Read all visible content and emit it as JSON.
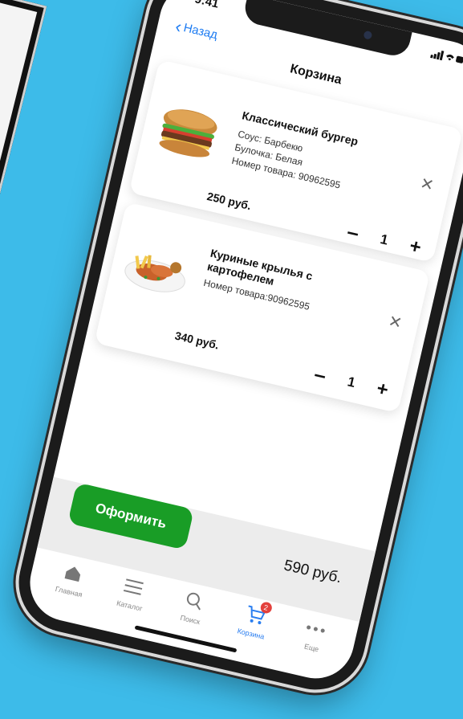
{
  "status": {
    "time": "9:41",
    "icons": "signal-wifi-battery"
  },
  "header": {
    "back_label": "Назад",
    "title": "Корзина"
  },
  "cart": {
    "items": [
      {
        "name": "Классический бургер",
        "details": [
          "Соус: Барбекю",
          "Булочка: Белая",
          "Номер товара: 90962595"
        ],
        "price": "250 руб.",
        "quantity": "1",
        "image": "burger-image"
      },
      {
        "name": "Куриные крылья с картофелем",
        "details": [
          "Номер товара:90962595"
        ],
        "price": "340 руб.",
        "quantity": "1",
        "image": "chicken-wings-image"
      }
    ],
    "checkout_label": "Оформить",
    "total": "590 руб."
  },
  "tabbar": {
    "tabs": [
      {
        "label": "Главная",
        "icon": "home-icon"
      },
      {
        "label": "Каталог",
        "icon": "menu-icon"
      },
      {
        "label": "Поиск",
        "icon": "search-icon"
      },
      {
        "label": "Корзина",
        "icon": "cart-icon",
        "badge": "2",
        "active": true
      },
      {
        "label": "Еще",
        "icon": "more-icon"
      }
    ]
  },
  "colors": {
    "background": "#3dbbe9",
    "accent": "#199d26",
    "link": "#1e7cf2",
    "badge": "#e3413d"
  }
}
